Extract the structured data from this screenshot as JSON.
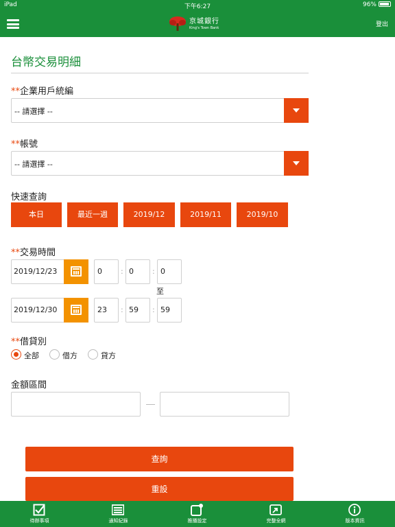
{
  "status_bar": {
    "device": "iPad",
    "time": "下午6:27",
    "battery": "96%"
  },
  "header": {
    "logo_name_cn": "京城銀行",
    "logo_name_en": "King's Town Bank",
    "logout_label": "登出",
    "menu_icon": "hamburger-menu-icon"
  },
  "page": {
    "title": "台幣交易明細"
  },
  "form": {
    "required_mark": "**",
    "company_id": {
      "label": "企業用戶統編",
      "value": "-- 請選擇 --"
    },
    "account": {
      "label": "帳號",
      "value": "-- 請選擇 --"
    },
    "quick_query": {
      "label": "快速查詢",
      "buttons": [
        "本日",
        "最近一週",
        "2019/12",
        "2019/11",
        "2019/10"
      ]
    },
    "tx_time": {
      "label": "交易時間",
      "start": {
        "date": "2019/12/23",
        "hour": "0",
        "minute": "0",
        "second": "0"
      },
      "to_label": "至",
      "end": {
        "date": "2019/12/30",
        "hour": "23",
        "minute": "59",
        "second": "59"
      },
      "separator": ":"
    },
    "debit_credit": {
      "label": "借貸別",
      "options": [
        "全部",
        "借方",
        "貸方"
      ],
      "selected": "全部"
    },
    "amount_range": {
      "label": "金額區間",
      "from": "",
      "to": ""
    },
    "query_button": "查詢",
    "reset_button": "重設"
  },
  "tab_bar": {
    "items": [
      {
        "label": "待辦事項",
        "icon": "checklist-icon"
      },
      {
        "label": "通知紀錄",
        "icon": "notification-record-icon"
      },
      {
        "label": "推播設定",
        "icon": "push-settings-icon"
      },
      {
        "label": "完整全網",
        "icon": "full-site-icon"
      },
      {
        "label": "版本資訊",
        "icon": "info-icon"
      }
    ]
  },
  "colors": {
    "brand_green": "#1a8f3a",
    "accent_orange": "#e8470e",
    "calendar_orange": "#f39200"
  }
}
